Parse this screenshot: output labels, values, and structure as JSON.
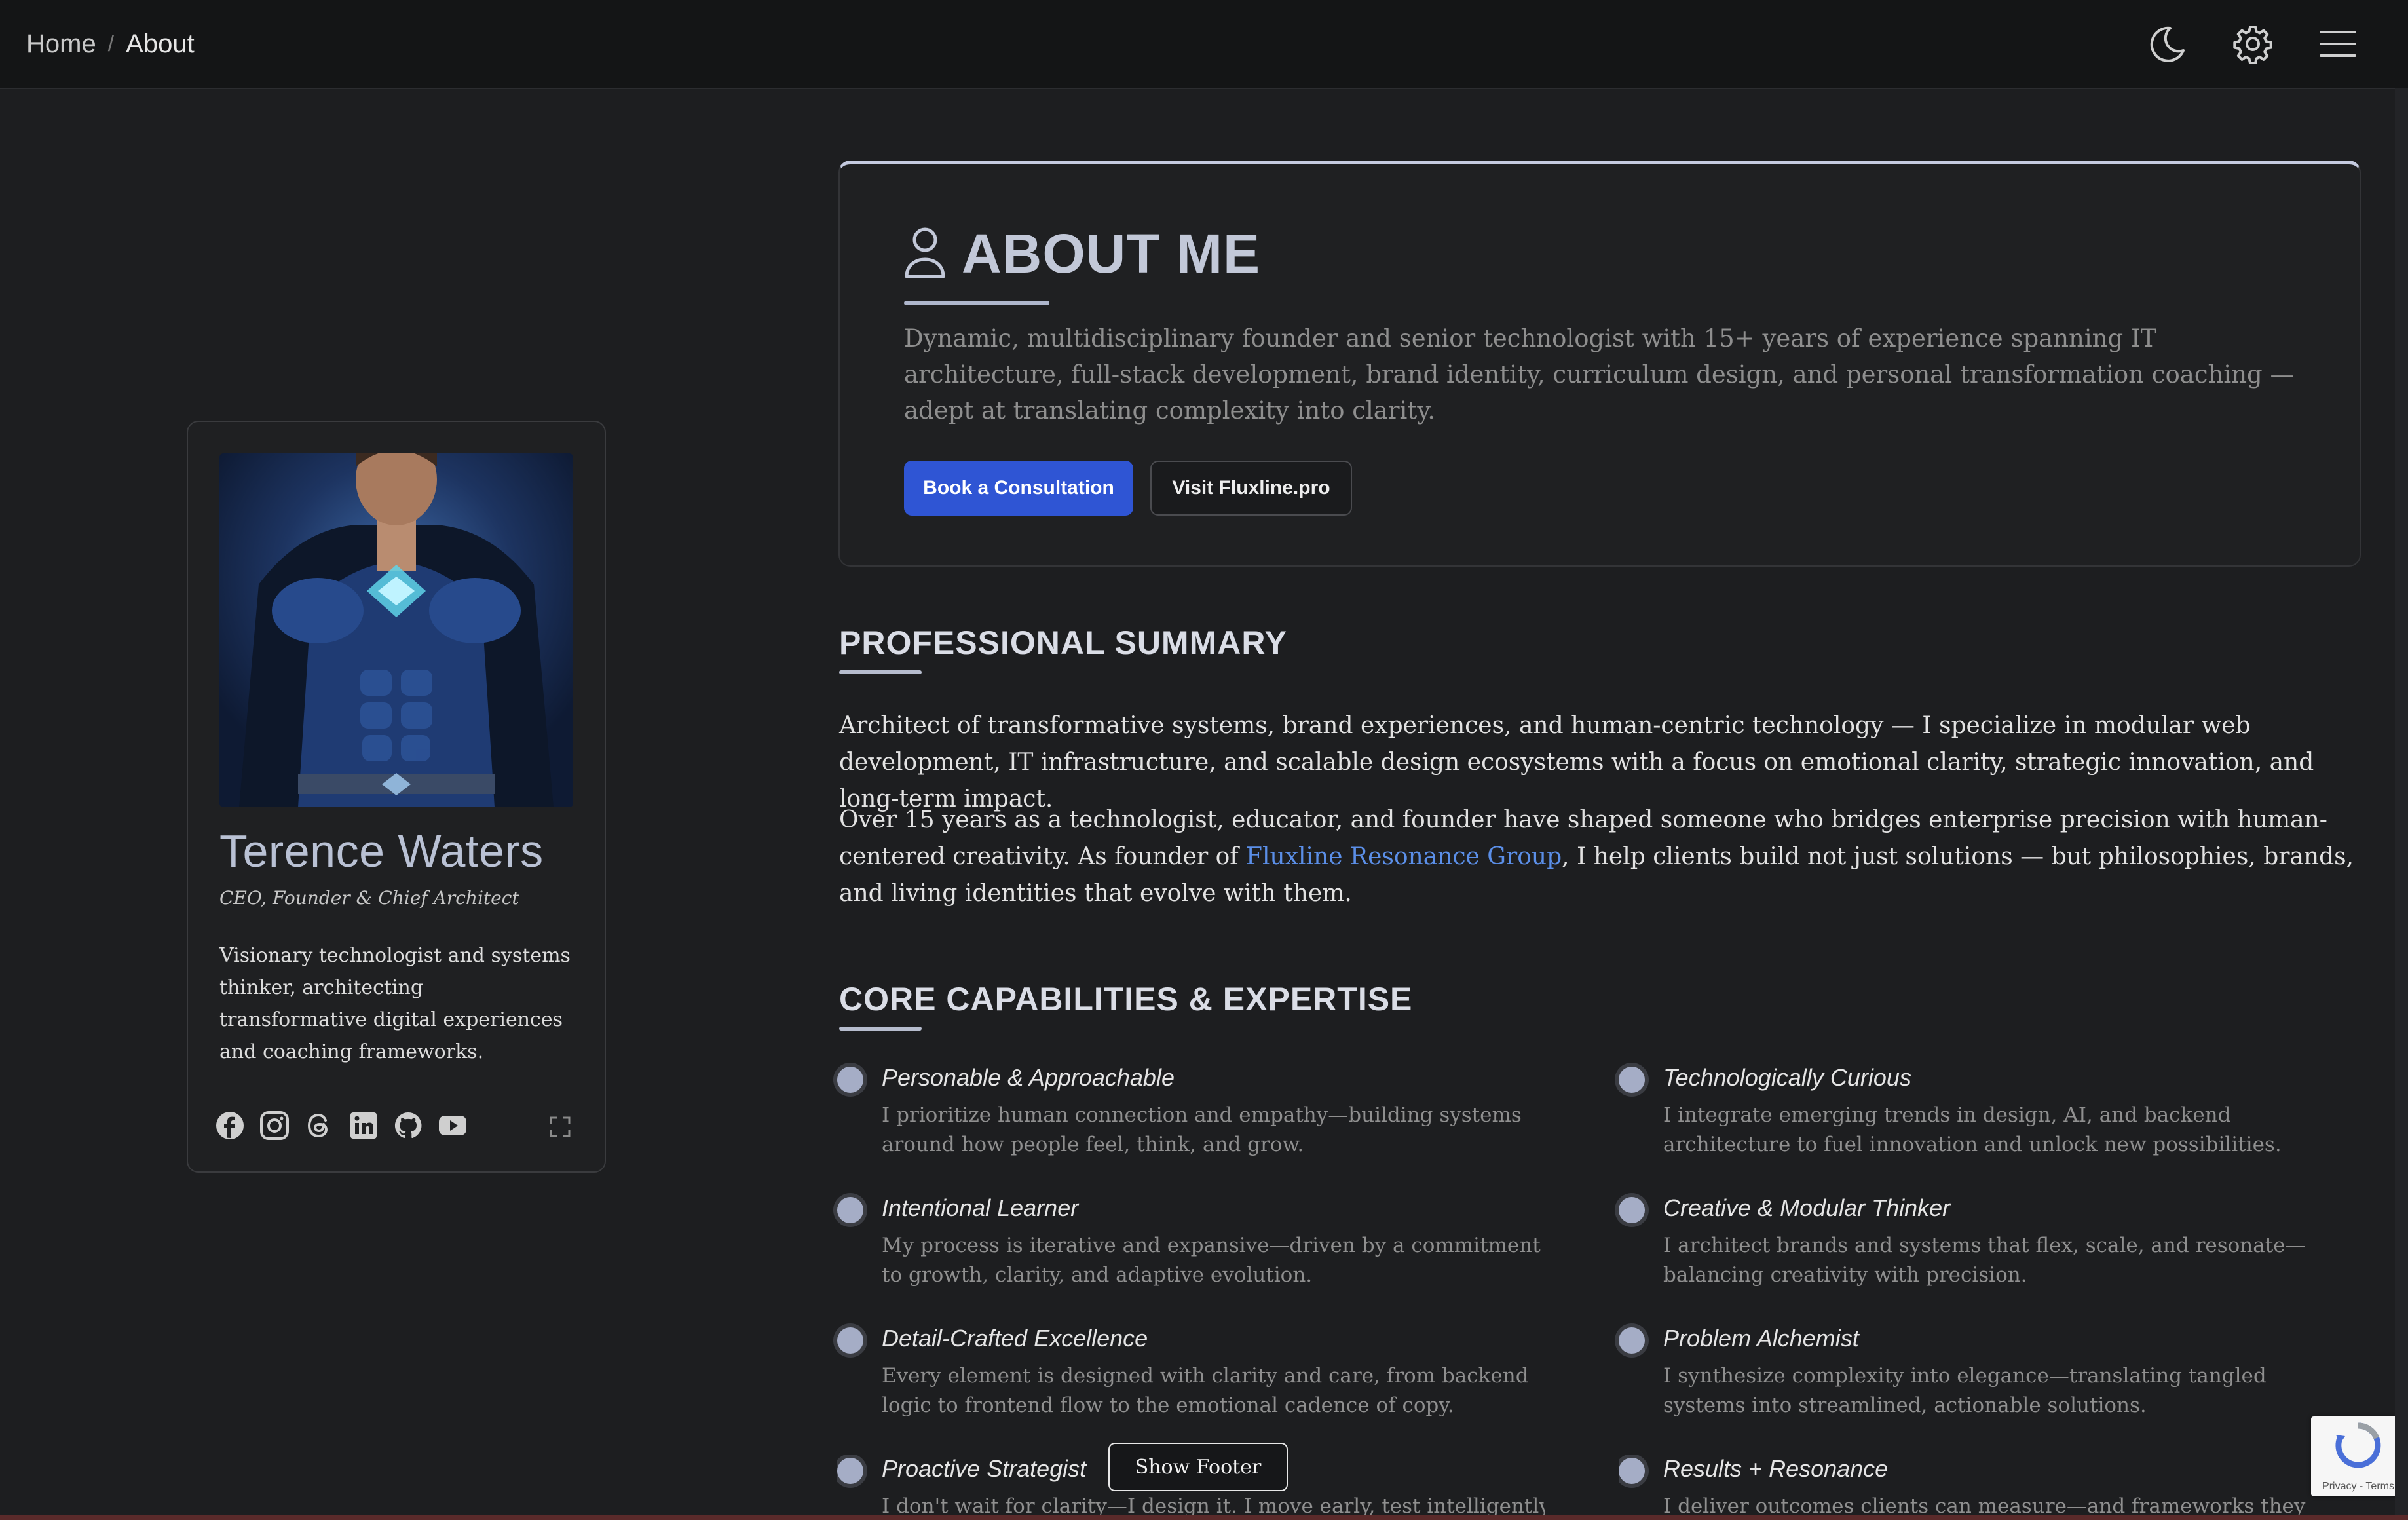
{
  "breadcrumb": {
    "home": "Home",
    "separator": "/",
    "current": "About"
  },
  "topbar": {
    "icons": [
      "moon-icon",
      "gear-icon",
      "hamburger-menu-icon"
    ]
  },
  "profile": {
    "name": "Terence Waters",
    "title": "CEO, Founder & Chief Architect",
    "bio": "Visionary technologist and systems thinker, architecting transformative digital experiences and coaching frameworks.",
    "socials": [
      "facebook-icon",
      "instagram-icon",
      "threads-icon",
      "linkedin-icon",
      "github-icon",
      "youtube-icon"
    ]
  },
  "about": {
    "heading": "ABOUT ME",
    "text": "Dynamic, multidisciplinary founder and senior technologist with 15+ years of experience spanning IT architecture, full-stack development, brand identity, curriculum design, and personal transformation coaching — adept at translating complexity into clarity.",
    "primary_button": "Book a Consultation",
    "secondary_button": "Visit Fluxline.pro"
  },
  "summary": {
    "heading": "PROFESSIONAL SUMMARY",
    "p1": "Architect of transformative systems, brand experiences, and human-centric technology — I specialize in modular web development, IT infrastructure, and scalable design ecosystems with a focus on emotional clarity, strategic innovation, and long-term impact.",
    "p2_a": "Over 15 years as a technologist, educator, and founder have shaped someone who bridges enterprise precision with human-centered creativity. As founder of ",
    "p2_link": "Fluxline Resonance Group",
    "p2_b": ", I help clients build not just solutions — but philosophies, brands, and living identities that evolve with them."
  },
  "capabilities": {
    "heading": "CORE CAPABILITIES & EXPERTISE",
    "items": [
      {
        "title": "Personable & Approachable",
        "desc": "I prioritize human connection and empathy—building systems around how people feel, think, and grow."
      },
      {
        "title": "Technologically Curious",
        "desc": "I integrate emerging trends in design, AI, and backend architecture to fuel innovation and unlock new possibilities."
      },
      {
        "title": "Intentional Learner",
        "desc": "My process is iterative and expansive—driven by a commitment to growth, clarity, and adaptive evolution."
      },
      {
        "title": "Creative & Modular Thinker",
        "desc": "I architect brands and systems that flex, scale, and resonate—balancing creativity with precision."
      },
      {
        "title": "Detail-Crafted Excellence",
        "desc": "Every element is designed with clarity and care, from backend logic to frontend flow to the emotional cadence of copy."
      },
      {
        "title": "Problem Alchemist",
        "desc": "I synthesize complexity into elegance—translating tangled systems into streamlined, actionable solutions."
      },
      {
        "title": "Proactive Strategist",
        "desc": "I don't wait for clarity—I design it. I move early, test intelligently, and"
      },
      {
        "title": "Results + Resonance",
        "desc": "I deliver outcomes clients can measure—and frameworks they can feel."
      }
    ]
  },
  "show_footer": "Show Footer",
  "recaptcha": {
    "text": "Privacy - Terms"
  },
  "colors": {
    "accent": "#2f55d4",
    "link": "#5b8fe8",
    "heading": "#c2c8d8",
    "background": "#1d1e20"
  }
}
